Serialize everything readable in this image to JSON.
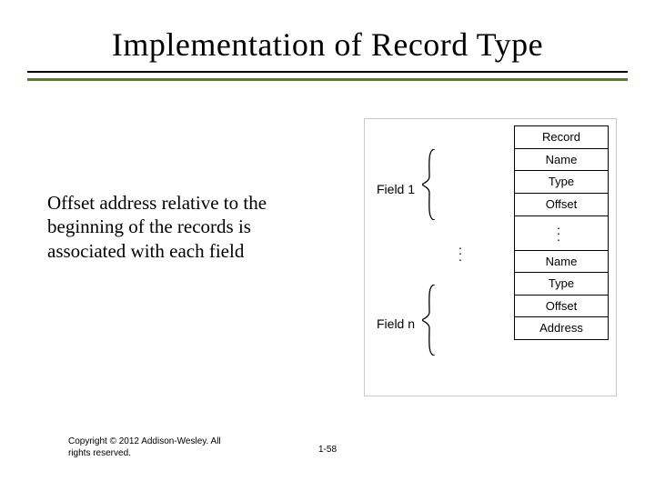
{
  "title": "Implementation of Record Type",
  "body": "Offset address relative to the beginning of the records is associated with each field",
  "diagram": {
    "field1_label": "Field 1",
    "fieldn_label": "Field n",
    "cells_top": [
      "Record",
      "Name",
      "Type",
      "Offset"
    ],
    "cells_bottom": [
      "Name",
      "Type",
      "Offset",
      "Address"
    ]
  },
  "footer": {
    "copyright": "Copyright © 2012 Addison-Wesley. All rights reserved.",
    "page": "1-58"
  }
}
